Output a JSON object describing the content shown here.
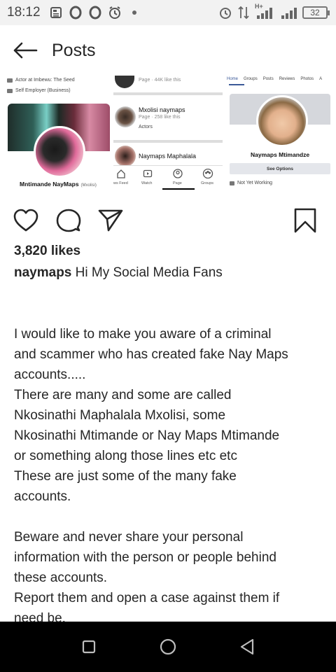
{
  "status_bar": {
    "time": "18:12",
    "battery": "32",
    "network": "H+"
  },
  "header": {
    "title": "Posts"
  },
  "post_image": {
    "left_panel": {
      "line1": "Actor at Imbewu: The Seed",
      "line2": "Self Employer (Business)",
      "name": "Mntimande NayMaps",
      "name_suffix": "(Mxolisi)"
    },
    "middle_panel": {
      "top_line": "Page · 44K like this",
      "item1_name": "Mxolisi naymaps",
      "item1_sub": "Page · 258 like this",
      "item1_cat": "Actors",
      "item2_name": "Naymaps Maphalala",
      "tabs": [
        "ws Feed",
        "Watch",
        "Page",
        "Groups"
      ]
    },
    "right_panel": {
      "tabs": [
        "Home",
        "Groups",
        "Posts",
        "Reviews",
        "Photos",
        "A"
      ],
      "name": "Naymaps Mtimandze",
      "button": "See Options",
      "footer": "Not Yet Working"
    }
  },
  "post": {
    "likes": "3,820 likes",
    "username": "naymaps",
    "caption_first": "Hi My Social Media Fans",
    "caption_lines": [
      "",
      "I would like to make you aware of a criminal",
      "and scammer who has created fake Nay Maps",
      "accounts.....",
      "There are many and some are called",
      "Nkosinathi Maphalala Mxolisi, some",
      "Nkosinathi Mtimande or Nay Maps Mtimande",
      "or something along those lines etc etc",
      "These are just some of the many fake",
      "accounts.",
      "",
      "Beware and never share your personal",
      "information with the person or people behind",
      "these accounts.",
      "Report them and open a case against them if",
      "need be."
    ]
  },
  "colors": {
    "text": "#262626",
    "nav_bar": "#000000",
    "status_bar": "#f2f2f2",
    "fb_blue": "#3b5998"
  }
}
